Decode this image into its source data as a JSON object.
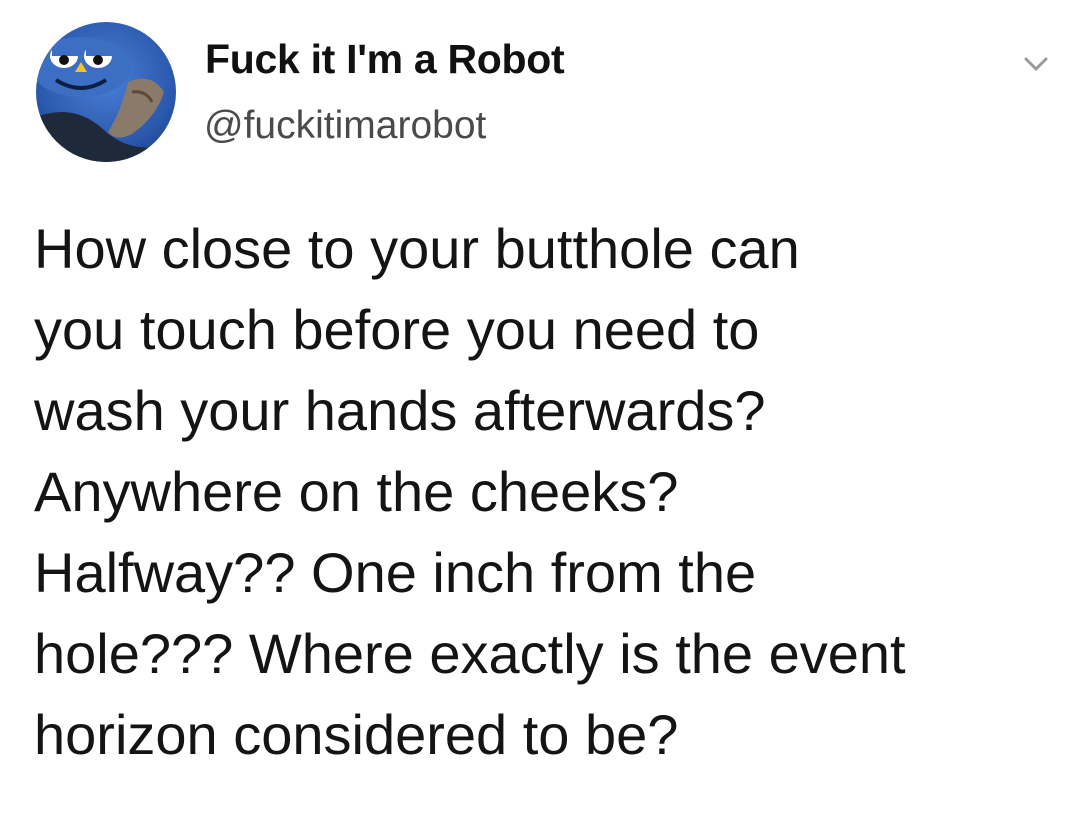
{
  "author": {
    "display_name": "Fuck it I'm a Robot",
    "handle": "@fuckitimarobot",
    "avatar_icon": "robot-avatar-icon"
  },
  "menu": {
    "icon": "chevron-down-icon"
  },
  "tweet": {
    "lines": [
      "How close to your butthole can",
      "you touch before you need to",
      "wash your hands afterwards?",
      "Anywhere on the cheeks?",
      "Halfway?? One inch from the",
      "hole??? Where exactly is the event",
      "horizon considered to be?"
    ]
  },
  "colors": {
    "background": "#ffffff",
    "text": "#141414",
    "handle": "#4a4a4a",
    "avatar_blue": "#2f5fb8"
  }
}
